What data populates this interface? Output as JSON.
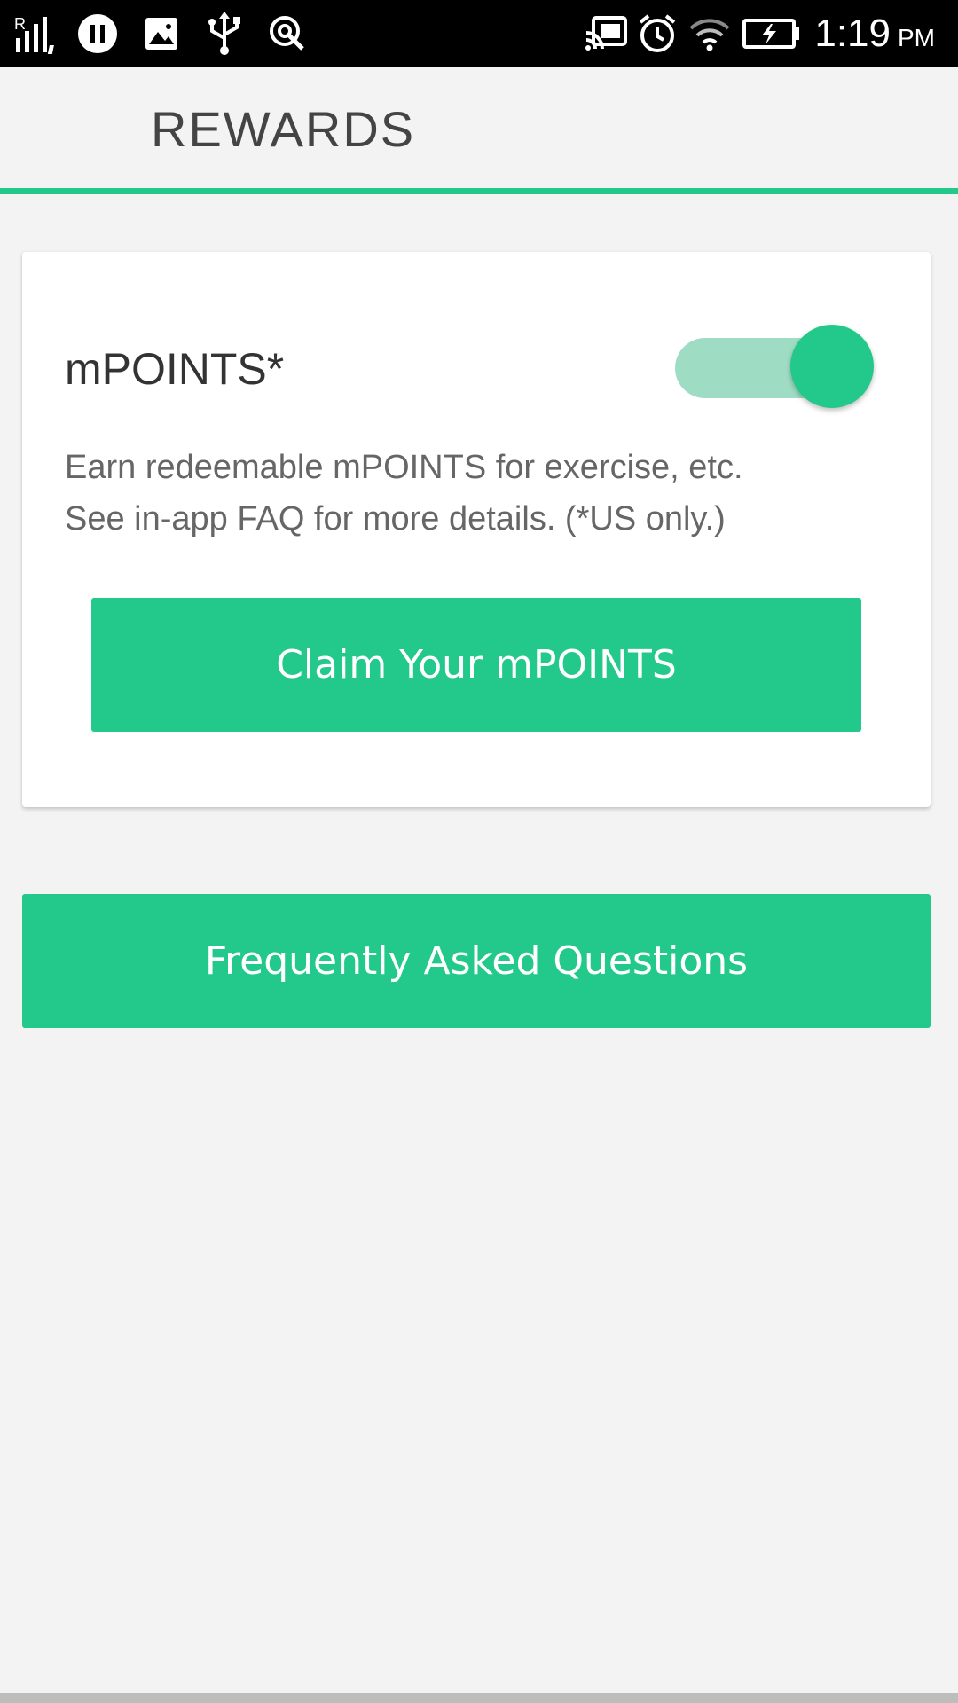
{
  "status_bar": {
    "time": "1:19",
    "ampm": "PM",
    "icons_left": [
      "signal-roaming-icon",
      "pause-icon",
      "image-icon",
      "usb-icon",
      "location-icon"
    ],
    "icons_right": [
      "cast-icon",
      "alarm-icon",
      "wifi-icon",
      "battery-charging-icon"
    ]
  },
  "header": {
    "title": "REWARDS"
  },
  "card": {
    "title": "mPOINTS*",
    "toggle_on": true,
    "description_lines": [
      "Earn redeemable mPOINTS for exercise, etc.",
      "See in-app FAQ for more details. (*US only.)"
    ],
    "claim_button": "Claim Your mPOINTS"
  },
  "faq_button": "Frequently Asked Questions",
  "colors": {
    "accent": "#22c98a",
    "accent_light": "#9fdcc4",
    "background": "#f3f3f3",
    "card": "#ffffff",
    "status_bar": "#000000"
  }
}
